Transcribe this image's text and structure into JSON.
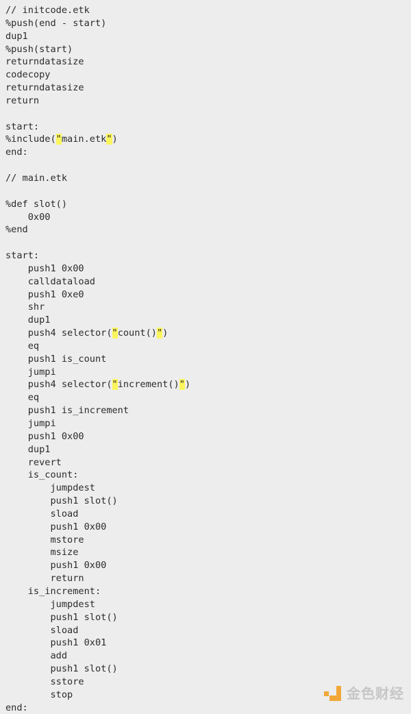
{
  "document": {
    "kind": "code-listing",
    "language": "etk",
    "background_color": "#ededed",
    "text_color": "#2b2b2b",
    "highlight_color": "#fbf55e",
    "lines": [
      {
        "text": "// initcode.etk"
      },
      {
        "text": "%push(end - start)"
      },
      {
        "text": "dup1"
      },
      {
        "text": "%push(start)"
      },
      {
        "text": "returndatasize"
      },
      {
        "text": "codecopy"
      },
      {
        "text": "returndatasize"
      },
      {
        "text": "return"
      },
      {
        "text": ""
      },
      {
        "text": "start:"
      },
      {
        "segments": [
          {
            "t": "%include("
          },
          {
            "t": "\"",
            "hl": true
          },
          {
            "t": "main.etk"
          },
          {
            "t": "\"",
            "hl": true
          },
          {
            "t": ")"
          }
        ]
      },
      {
        "text": "end:"
      },
      {
        "text": ""
      },
      {
        "text": "// main.etk"
      },
      {
        "text": ""
      },
      {
        "text": "%def slot()"
      },
      {
        "text": "    0x00"
      },
      {
        "text": "%end"
      },
      {
        "text": ""
      },
      {
        "text": "start:"
      },
      {
        "text": "    push1 0x00"
      },
      {
        "text": "    calldataload"
      },
      {
        "text": "    push1 0xe0"
      },
      {
        "text": "    shr"
      },
      {
        "text": "    dup1"
      },
      {
        "segments": [
          {
            "t": "    push4 selector("
          },
          {
            "t": "\"",
            "hl": true
          },
          {
            "t": "count()"
          },
          {
            "t": "\"",
            "hl": true
          },
          {
            "t": ")"
          }
        ]
      },
      {
        "text": "    eq"
      },
      {
        "text": "    push1 is_count"
      },
      {
        "text": "    jumpi"
      },
      {
        "segments": [
          {
            "t": "    push4 selector("
          },
          {
            "t": "\"",
            "hl": true
          },
          {
            "t": "increment()"
          },
          {
            "t": "\"",
            "hl": true
          },
          {
            "t": ")"
          }
        ]
      },
      {
        "text": "    eq"
      },
      {
        "text": "    push1 is_increment"
      },
      {
        "text": "    jumpi"
      },
      {
        "text": "    push1 0x00"
      },
      {
        "text": "    dup1"
      },
      {
        "text": "    revert"
      },
      {
        "text": "    is_count:"
      },
      {
        "text": "        jumpdest"
      },
      {
        "text": "        push1 slot()"
      },
      {
        "text": "        sload"
      },
      {
        "text": "        push1 0x00"
      },
      {
        "text": "        mstore"
      },
      {
        "text": "        msize"
      },
      {
        "text": "        push1 0x00"
      },
      {
        "text": "        return"
      },
      {
        "text": "    is_increment:"
      },
      {
        "text": "        jumpdest"
      },
      {
        "text": "        push1 slot()"
      },
      {
        "text": "        sload"
      },
      {
        "text": "        push1 0x01"
      },
      {
        "text": "        add"
      },
      {
        "text": "        push1 slot()"
      },
      {
        "text": "        sstore"
      },
      {
        "text": "        stop"
      },
      {
        "text": "end:"
      }
    ]
  },
  "watermark": {
    "text": "金色财经",
    "logo_color": "#f2a329",
    "text_color": "#c3c3c3"
  }
}
